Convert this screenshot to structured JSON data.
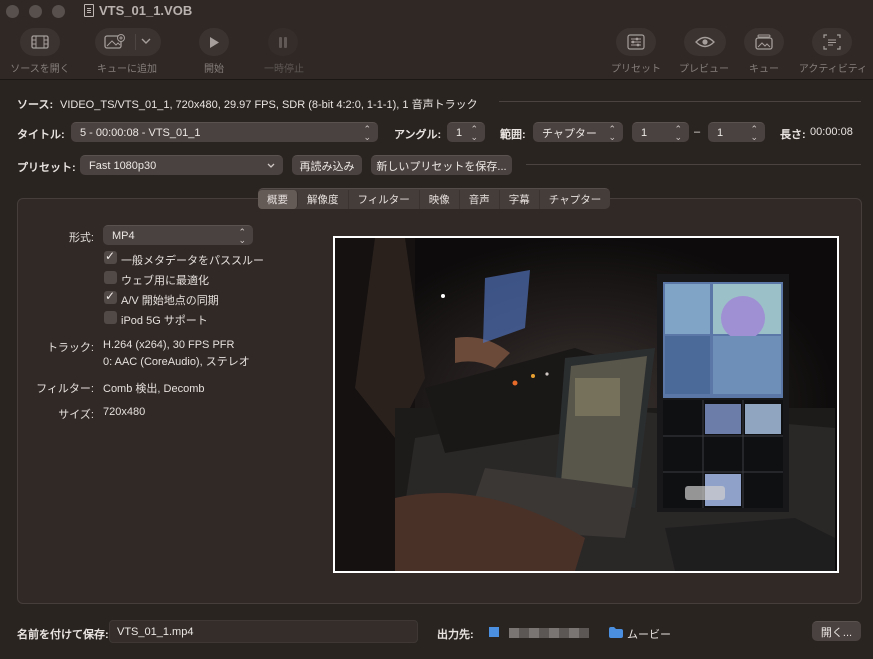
{
  "window": {
    "title": "VTS_01_1.VOB"
  },
  "toolbar": {
    "open_source": "ソースを開く",
    "add_to_queue": "キューに追加",
    "start": "開始",
    "pause": "一時停止",
    "presets": "プリセット",
    "preview": "プレビュー",
    "queue": "キュー",
    "activity": "アクティビティ"
  },
  "source": {
    "label": "ソース:",
    "value": "VIDEO_TS/VTS_01_1, 720x480, 29.97 FPS, SDR (8-bit 4:2:0, 1-1-1), 1 音声トラック"
  },
  "title_row": {
    "title_label": "タイトル:",
    "title_value": "5 - 00:00:08 - VTS_01_1",
    "angle_label": "アングル:",
    "angle_value": "1",
    "range_label": "範囲:",
    "range_type": "チャプター",
    "range_start": "1",
    "range_dash": "–",
    "range_end": "1",
    "duration_label": "長さ:",
    "duration_value": "00:00:08"
  },
  "preset_row": {
    "label": "プリセット:",
    "value": "Fast 1080p30",
    "reload": "再読み込み",
    "save_new": "新しいプリセットを保存..."
  },
  "tabs": [
    "概要",
    "解像度",
    "フィルター",
    "映像",
    "音声",
    "字幕",
    "チャプター"
  ],
  "summary": {
    "format_label": "形式:",
    "format_value": "MP4",
    "checkboxes": [
      {
        "label": "一般メタデータをパススルー",
        "checked": true
      },
      {
        "label": "ウェブ用に最適化",
        "checked": false
      },
      {
        "label": "A/V 開始地点の同期",
        "checked": true
      },
      {
        "label": "iPod 5G サポート",
        "checked": false
      }
    ],
    "tracks_label": "トラック:",
    "tracks_line1": "H.264 (x264), 30 FPS PFR",
    "tracks_line2": "0: AAC (CoreAudio), ステレオ",
    "filters_label": "フィルター:",
    "filters_value": "Comb 検出, Decomb",
    "size_label": "サイズ:",
    "size_value": "720x480"
  },
  "bottom": {
    "save_as_label": "名前を付けて保存:",
    "save_as_value": "VTS_01_1.mp4",
    "destination_label": "出力先:",
    "folder_name": "ムービー",
    "open_button": "開く..."
  },
  "colors": {
    "accent_folder": "#4a8fe0",
    "background": "#2a2421",
    "panel": "#302926"
  }
}
